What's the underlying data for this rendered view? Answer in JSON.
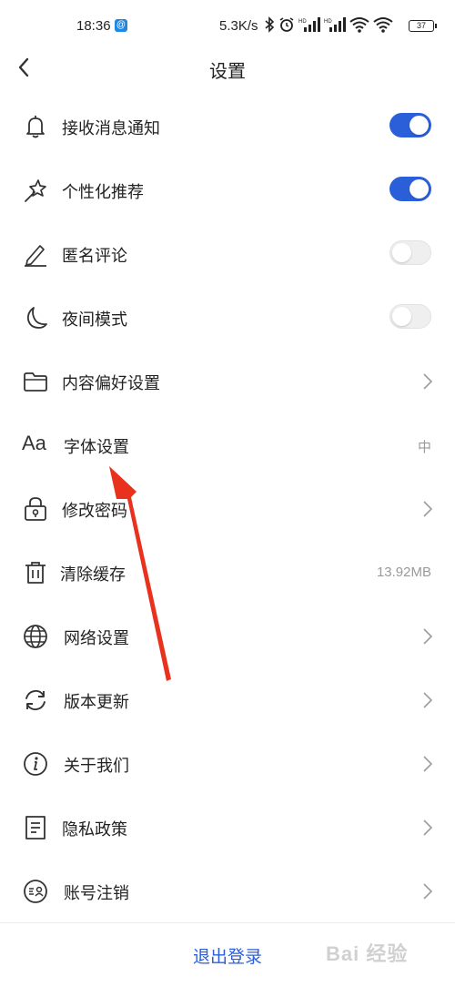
{
  "status_bar": {
    "time": "18:36",
    "app_badge": "@",
    "net_speed": "5.3K/s",
    "battery": "37",
    "icons": [
      "bluetooth-icon",
      "alarm-icon",
      "signal-hd-icon",
      "signal-hd-icon",
      "wifi-icon",
      "wifi-icon",
      "battery-icon"
    ]
  },
  "nav": {
    "title": "设置",
    "back_icon": "back-arrow-icon"
  },
  "settings": [
    {
      "label": "接收消息通知",
      "icon": "bell-icon",
      "control": "toggle",
      "on": true
    },
    {
      "label": "个性化推荐",
      "icon": "magic-wand-icon",
      "control": "toggle",
      "on": true
    },
    {
      "label": "匿名评论",
      "icon": "pencil-icon",
      "control": "toggle",
      "on": false
    },
    {
      "label": "夜间模式",
      "icon": "moon-icon",
      "control": "toggle",
      "on": false
    },
    {
      "label": "内容偏好设置",
      "icon": "folder-icon",
      "control": "chevron"
    },
    {
      "label": "字体设置",
      "icon": "font-icon",
      "control": "value",
      "value": "中",
      "icon_text": "Aa"
    },
    {
      "label": "修改密码",
      "icon": "lock-icon",
      "control": "chevron"
    },
    {
      "label": "清除缓存",
      "icon": "trash-icon",
      "control": "value",
      "value": "13.92MB"
    },
    {
      "label": "网络设置",
      "icon": "globe-icon",
      "control": "chevron"
    },
    {
      "label": "版本更新",
      "icon": "refresh-icon",
      "control": "chevron"
    },
    {
      "label": "关于我们",
      "icon": "info-icon",
      "control": "chevron"
    },
    {
      "label": "隐私政策",
      "icon": "document-icon",
      "control": "chevron"
    },
    {
      "label": "账号注销",
      "icon": "account-cancel-icon",
      "control": "chevron"
    }
  ],
  "logout_label": "退出登录",
  "watermark": "Bai 经验",
  "colors": {
    "accent": "#2b5fd9",
    "annotation_arrow": "#e8321e"
  }
}
